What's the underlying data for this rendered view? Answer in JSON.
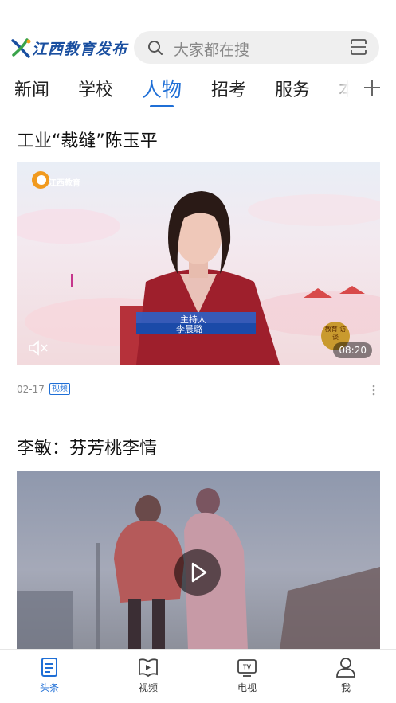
{
  "header": {
    "logo_text": "江西教育发布",
    "search_placeholder": "大家都在搜"
  },
  "tabs": [
    {
      "label": "新闻",
      "active": false
    },
    {
      "label": "学校",
      "active": false
    },
    {
      "label": "人物",
      "active": true
    },
    {
      "label": "招考",
      "active": false
    },
    {
      "label": "服务",
      "active": false
    },
    {
      "label": "本",
      "active": false
    }
  ],
  "articles": [
    {
      "title": "工业“裁缝”陈玉平",
      "date": "02-17",
      "badge": "视频",
      "video": {
        "channel_logo": "江西教育",
        "lower_third_role": "主持人",
        "lower_third_name": "李晨璐",
        "duration": "08:20",
        "corner_stamp": "教育 访谈"
      }
    },
    {
      "title": "李敏：芬芳桃李情"
    }
  ],
  "bottom_nav": [
    {
      "label": "头条",
      "icon": "headlines-icon",
      "active": true
    },
    {
      "label": "视频",
      "icon": "video-book-icon",
      "active": false
    },
    {
      "label": "电视",
      "icon": "tv-icon",
      "active": false
    },
    {
      "label": "我",
      "icon": "profile-icon",
      "active": false
    }
  ],
  "colors": {
    "accent": "#1f6fd6",
    "logo": "#1a4fa0",
    "search_bg": "#efefef"
  }
}
